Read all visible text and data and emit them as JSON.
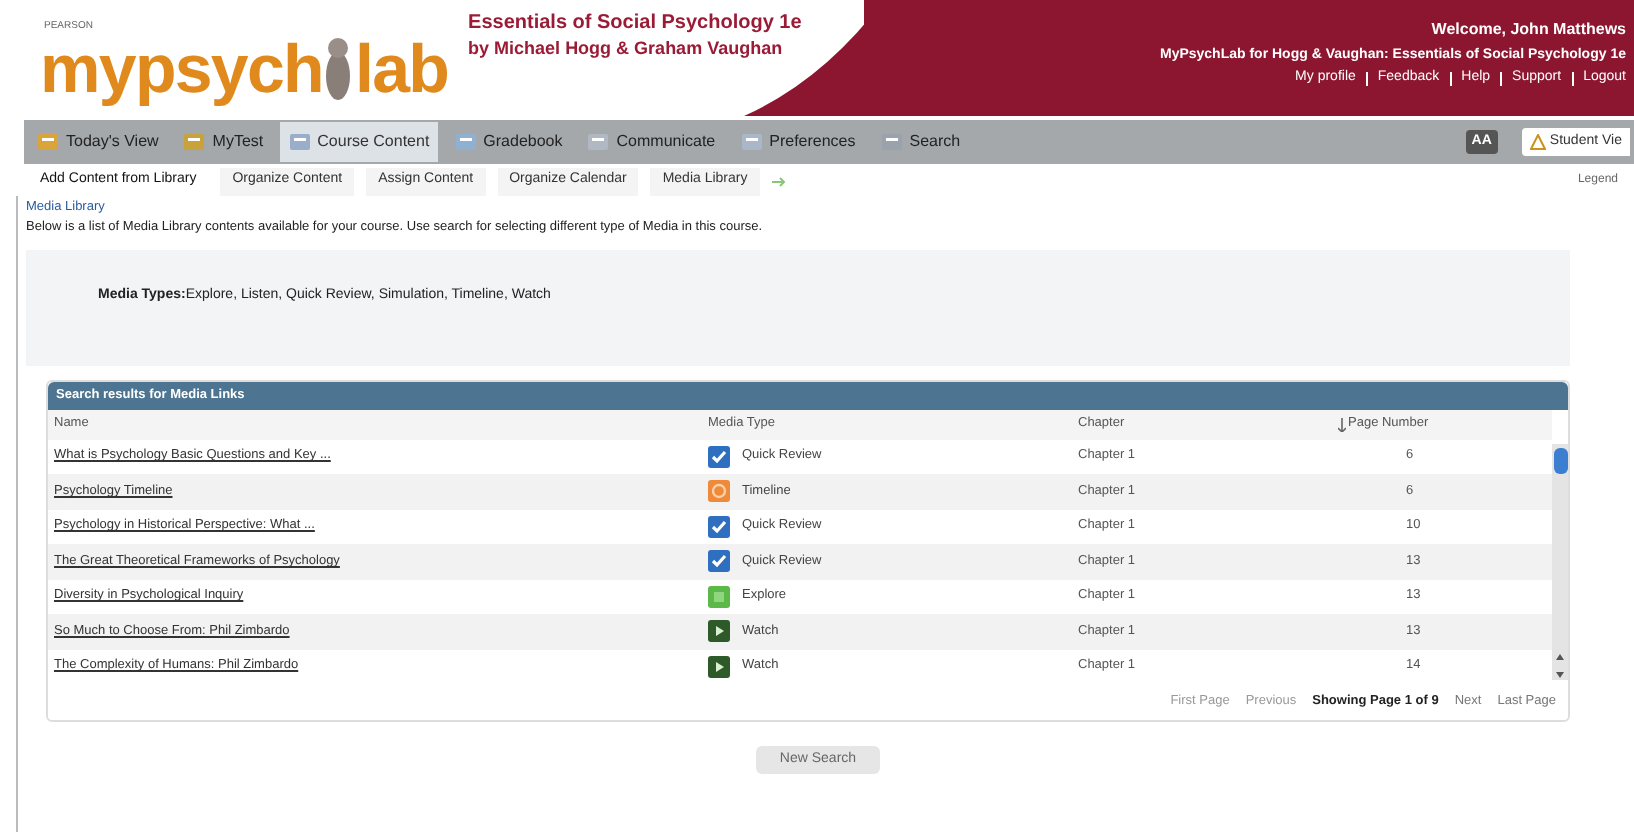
{
  "header": {
    "publisher": "PEARSON",
    "logo_left": "mypsych",
    "logo_right": "lab",
    "book_title": "Essentials of Social Psychology 1e",
    "book_authors": "by Michael Hogg & Graham Vaughan",
    "welcome": "Welcome, John Matthews",
    "course": "MyPsychLab for Hogg & Vaughan: Essentials of Social Psychology 1e",
    "links": [
      "My profile",
      "Feedback",
      "Help",
      "Support",
      "Logout"
    ]
  },
  "nav": [
    {
      "label": "Today's View",
      "selected": false
    },
    {
      "label": "MyTest",
      "selected": false
    },
    {
      "label": "Course Content",
      "selected": true
    },
    {
      "label": "Gradebook",
      "selected": false
    },
    {
      "label": "Communicate",
      "selected": false
    },
    {
      "label": "Preferences",
      "selected": false
    },
    {
      "label": "Search",
      "selected": false
    }
  ],
  "text_size_button": "AA",
  "student_view_button": "Student Vie",
  "subnav": [
    {
      "label": "Add Content from Library",
      "selected": true
    },
    {
      "label": "Organize Content",
      "selected": false
    },
    {
      "label": "Assign Content",
      "selected": false
    },
    {
      "label": "Organize Calendar",
      "selected": false
    },
    {
      "label": "Media Library",
      "selected": false
    }
  ],
  "legend_link": "Legend",
  "page_title": "Media Library",
  "description": "Below is a list of Media Library  contents available for your course. Use search for selecting different type of Media in this course.",
  "media_types": "**Media Types:**Explore, Listen, Quick Review, Simulation, Timeline, Watch",
  "results": {
    "title": "Search results for Media Links",
    "columns": [
      "Name",
      "Media Type",
      "Chapter",
      "Page Number"
    ],
    "rows": [
      {
        "name": "What is Psychology Basic Questions and Key ...",
        "kind": "quick-review",
        "media_type": "Quick Review",
        "chapter": "Chapter 1",
        "page": "6"
      },
      {
        "name": "Psychology Timeline",
        "kind": "timeline",
        "media_type": "Timeline",
        "chapter": "Chapter 1",
        "page": "6"
      },
      {
        "name": "Psychology in Historical Perspective: What ...",
        "kind": "quick-review",
        "media_type": "Quick Review",
        "chapter": "Chapter 1",
        "page": "10"
      },
      {
        "name": "The Great Theoretical Frameworks of Psychology",
        "kind": "quick-review",
        "media_type": "Quick Review",
        "chapter": "Chapter 1",
        "page": "13"
      },
      {
        "name": "Diversity in Psychological Inquiry",
        "kind": "explore",
        "media_type": "Explore",
        "chapter": "Chapter 1",
        "page": "13"
      },
      {
        "name": "So Much to Choose From: Phil Zimbardo",
        "kind": "watch",
        "media_type": "Watch",
        "chapter": "Chapter 1",
        "page": "13"
      },
      {
        "name": "The Complexity of Humans: Phil Zimbardo",
        "kind": "watch",
        "media_type": "Watch",
        "chapter": "Chapter 1",
        "page": "14"
      }
    ],
    "pager": {
      "first": "First Page",
      "previous": "Previous",
      "status": "Showing Page 1 of 9",
      "next": "Next",
      "last": "Last Page"
    }
  },
  "new_search_button": "New Search"
}
